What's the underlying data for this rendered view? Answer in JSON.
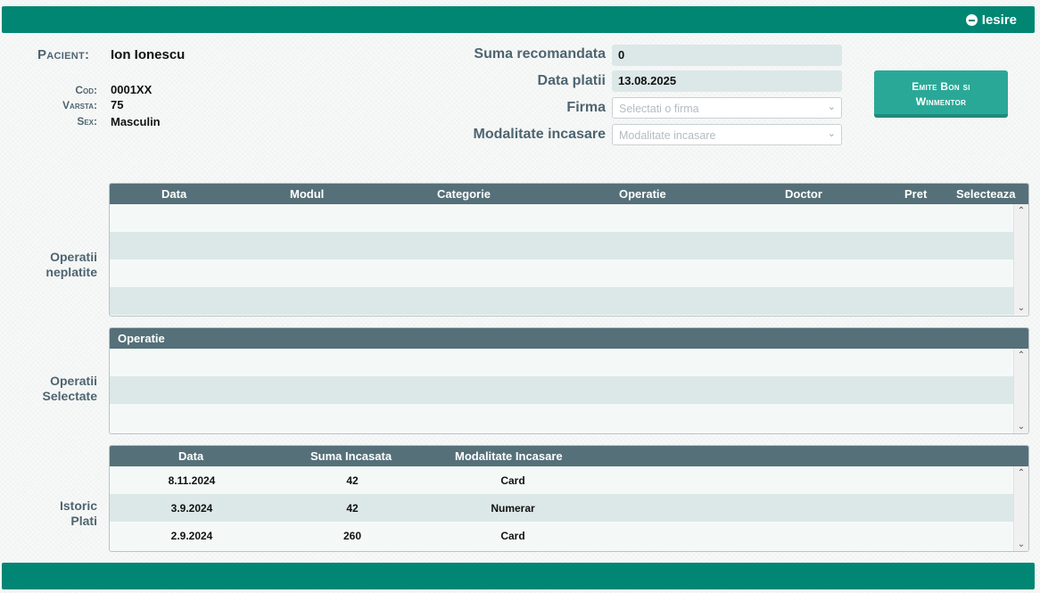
{
  "topbar": {
    "exit_label": "Iesire"
  },
  "patient": {
    "label": "Pacient:",
    "name": "Ion Ionescu",
    "cod_label": "Cod:",
    "cod": "0001XX",
    "varsta_label": "Varsta:",
    "varsta": "75",
    "sex_label": "Sex:",
    "sex": "Masculin"
  },
  "form": {
    "suma_label": "Suma recomandata",
    "suma_value": "0",
    "data_label": "Data platii",
    "data_value": "13.08.2025",
    "firma_label": "Firma",
    "firma_placeholder": "Selectati o firma",
    "modalitate_label": "Modalitate incasare",
    "modalitate_placeholder": "Modalitate incasare"
  },
  "emit_button": {
    "line1": "Emite Bon si",
    "line2": "Winmentor"
  },
  "operatii_neplatite": {
    "label_line1": "Operatii",
    "label_line2": "neplatite",
    "columns": [
      "Data",
      "Modul",
      "Categorie",
      "Operatie",
      "Doctor",
      "Pret",
      "Selecteaza"
    ]
  },
  "operatii_selectate": {
    "label_line1": "Operatii",
    "label_line2": "Selectate",
    "columns": [
      "Operatie"
    ]
  },
  "istoric_plati": {
    "label_line1": "Istoric",
    "label_line2": "Plati",
    "columns": [
      "Data",
      "Suma Incasata",
      "Modalitate Incasare"
    ],
    "rows": [
      {
        "data": "8.11.2024",
        "suma": "42",
        "modalitate": "Card"
      },
      {
        "data": "3.9.2024",
        "suma": "42",
        "modalitate": "Numerar"
      },
      {
        "data": "2.9.2024",
        "suma": "260",
        "modalitate": "Card"
      }
    ]
  },
  "colors": {
    "brand": "#008673",
    "header": "#557079",
    "label": "#4e6470",
    "button": "#2aa897"
  },
  "icons": {
    "exit": "minus-circle-icon",
    "chevron": "chevron-down-icon"
  }
}
